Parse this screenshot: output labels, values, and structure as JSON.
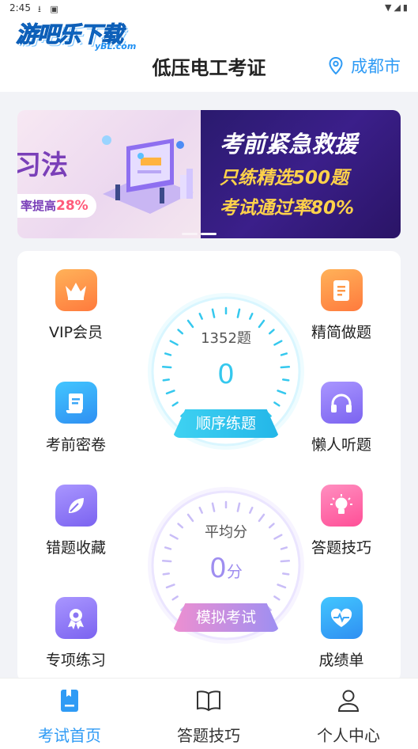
{
  "status_bar": {
    "time": "2:45"
  },
  "header": {
    "logo_text": "游吧乐下载",
    "logo_sub": "yBL.com",
    "title": "低压电工考证",
    "city": "成都市"
  },
  "banner": {
    "left_big": "习法",
    "left_pill_prefix": "率提高",
    "left_pill_value": "28%",
    "right_line1": "考前紧急救援",
    "right_line2": "只练精选500题",
    "right_line3": "考试通过率80%"
  },
  "features": {
    "vip": "VIP会员",
    "simple": "精简做题",
    "secret": "考前密卷",
    "listen": "懒人听题",
    "wrong": "错题收藏",
    "tips": "答题技巧",
    "special": "专项练习",
    "report": "成绩单"
  },
  "dial_practice": {
    "count": "1352题",
    "value": "0",
    "button": "顺序练题"
  },
  "dial_exam": {
    "label": "平均分",
    "value": "0",
    "unit": "分",
    "button": "模拟考试"
  },
  "tabs": {
    "home": "考试首页",
    "tips": "答题技巧",
    "profile": "个人中心"
  },
  "colors": {
    "accent": "#2f9bf5",
    "practice_dial": "#35c8ee",
    "exam_dial": "#9f8ef0"
  }
}
